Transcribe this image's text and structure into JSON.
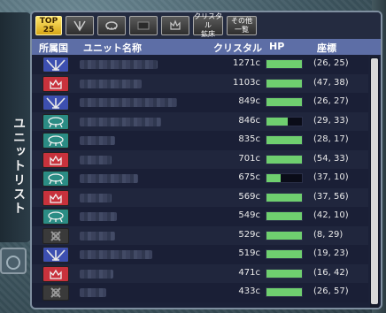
{
  "window": {
    "side_title": "ユニットリスト"
  },
  "tabs": [
    {
      "label": "TOP\n25",
      "active": true,
      "icon": "top25-label"
    },
    {
      "label": "",
      "active": false,
      "icon": "faction-blue-emblem-icon"
    },
    {
      "label": "",
      "active": false,
      "icon": "faction-teal-emblem-icon"
    },
    {
      "label": "",
      "active": false,
      "icon": "faction-black-emblem-icon"
    },
    {
      "label": "",
      "active": false,
      "icon": "faction-red-emblem-icon"
    },
    {
      "label": "クリスタル\n鉱床",
      "active": false,
      "icon": ""
    },
    {
      "label": "その他\n一覧",
      "active": false,
      "icon": ""
    }
  ],
  "columns": {
    "faction": "所属国",
    "name": "ユニット名称",
    "crystal": "クリスタル",
    "hp": "HP",
    "coords": "座標"
  },
  "colors": {
    "blue": "#3d4fb0",
    "red": "#c8323c",
    "teal": "#2b8c84",
    "black": "#3a3a3a",
    "hp": "#6fcf6f",
    "header": "#5d6ea6"
  },
  "rows": [
    {
      "faction": "blue",
      "crystal": "1271c",
      "hp": 1.0,
      "coords": "(26, 25)"
    },
    {
      "faction": "red",
      "crystal": "1103c",
      "hp": 1.0,
      "coords": "(47, 38)"
    },
    {
      "faction": "blue",
      "crystal": "849c",
      "hp": 1.0,
      "coords": "(26, 27)"
    },
    {
      "faction": "teal",
      "crystal": "846c",
      "hp": 0.6,
      "coords": "(29, 33)"
    },
    {
      "faction": "teal",
      "crystal": "835c",
      "hp": 1.0,
      "coords": "(28, 17)"
    },
    {
      "faction": "red",
      "crystal": "701c",
      "hp": 1.0,
      "coords": "(54, 33)"
    },
    {
      "faction": "teal",
      "crystal": "675c",
      "hp": 0.4,
      "coords": "(37, 10)"
    },
    {
      "faction": "red",
      "crystal": "569c",
      "hp": 1.0,
      "coords": "(37, 56)"
    },
    {
      "faction": "teal",
      "crystal": "549c",
      "hp": 1.0,
      "coords": "(42, 10)"
    },
    {
      "faction": "black",
      "crystal": "529c",
      "hp": 1.0,
      "coords": "(8, 29)"
    },
    {
      "faction": "blue",
      "crystal": "519c",
      "hp": 1.0,
      "coords": "(19, 23)"
    },
    {
      "faction": "red",
      "crystal": "471c",
      "hp": 1.0,
      "coords": "(16, 42)"
    },
    {
      "faction": "black",
      "crystal": "433c",
      "hp": 1.0,
      "coords": "(26, 57)"
    }
  ]
}
